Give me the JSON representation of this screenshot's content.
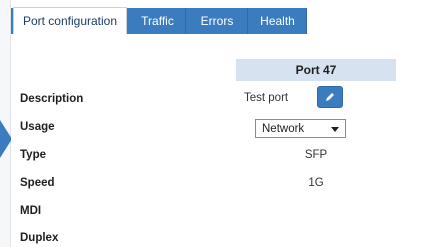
{
  "tabs": [
    {
      "label": "Port configuration",
      "active": true
    },
    {
      "label": "Traffic",
      "active": false
    },
    {
      "label": "Errors",
      "active": false
    },
    {
      "label": "Health",
      "active": false
    }
  ],
  "table": {
    "column_header": "Port 47",
    "rows": {
      "description": {
        "label": "Description",
        "value": "Test port"
      },
      "usage": {
        "label": "Usage",
        "value": "Network"
      },
      "type": {
        "label": "Type",
        "value": "SFP"
      },
      "speed": {
        "label": "Speed",
        "value": "1G"
      },
      "mdi": {
        "label": "MDI",
        "value": ""
      },
      "duplex": {
        "label": "Duplex",
        "value": ""
      }
    }
  },
  "icons": {
    "edit": "pencil-icon",
    "collapse": "arrow-right-icon"
  },
  "colors": {
    "accent": "#3b7cbf",
    "header_bg": "#d6e2ef"
  }
}
